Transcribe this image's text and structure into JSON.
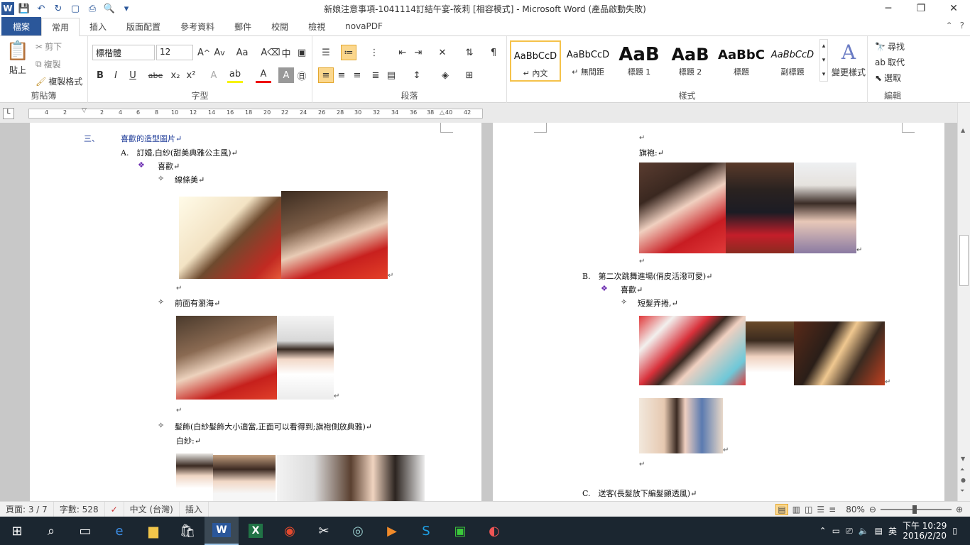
{
  "window": {
    "title": "新娘注意事項-1041114訂結午宴-筱莉 [相容模式] - Microsoft Word (產品啟動失敗)"
  },
  "tabs": [
    "檔案",
    "常用",
    "插入",
    "版面配置",
    "參考資料",
    "郵件",
    "校閱",
    "檢視",
    "novaPDF"
  ],
  "ribbon": {
    "clipboard": {
      "paste": "貼上",
      "cut": "剪下",
      "copy": "複製",
      "format_painter": "複製格式",
      "label": "剪貼簿"
    },
    "font": {
      "font_name": "標楷體",
      "font_size": "12",
      "label": "字型"
    },
    "paragraph": {
      "label": "段落"
    },
    "styles": {
      "label": "樣式",
      "items": [
        {
          "sample": "AaBbCcD",
          "name": "↵ 內文"
        },
        {
          "sample": "AaBbCcD",
          "name": "↵ 無間距"
        },
        {
          "sample": "AaB",
          "name": "標題 1"
        },
        {
          "sample": "AaB",
          "name": "標題 2"
        },
        {
          "sample": "AaBbC",
          "name": "標題"
        },
        {
          "sample": "AaBbCcD",
          "name": "副標題"
        }
      ],
      "change_styles": "變更樣式"
    },
    "editing": {
      "find": "尋找",
      "replace": "取代",
      "select": "選取",
      "label": "編輯"
    }
  },
  "ruler": {
    "ticks": [
      "4",
      "2",
      "2",
      "4",
      "6",
      "8",
      "10",
      "12",
      "14",
      "16",
      "18",
      "20",
      "22",
      "24",
      "26",
      "28",
      "30",
      "32",
      "34",
      "36",
      "38",
      "40",
      "42"
    ]
  },
  "doc": {
    "left": {
      "l1": "三、",
      "l1b": "喜歡的造型圖片↵",
      "l2": "A.　訂婚,白紗(甜美典雅公主風)↵",
      "l3": "喜歡↵",
      "l4": "線條美↵",
      "l5": "前面有瀏海↵",
      "l6": "髮飾(白紗髮飾大小適當,正面可以看得到;旗袍側放典雅)↵",
      "l7": "白紗:↵"
    },
    "right": {
      "r1": "旗袍:↵",
      "r2": "B.　第二次跳舞進場(俏皮活潑可愛)↵",
      "r3": "喜歡↵",
      "r4": "短髮弄捲,↵",
      "r5": "C.　送客(長髮放下編髮顯透風)↵"
    },
    "para_mark": "↵"
  },
  "status": {
    "page": "頁面: 3 / 7",
    "words": "字數: 528",
    "language": "中文 (台灣)",
    "mode": "插入",
    "zoom": "80%"
  },
  "taskbar": {
    "time": "下午 10:29",
    "date": "2016/2/20",
    "ime": "英"
  }
}
